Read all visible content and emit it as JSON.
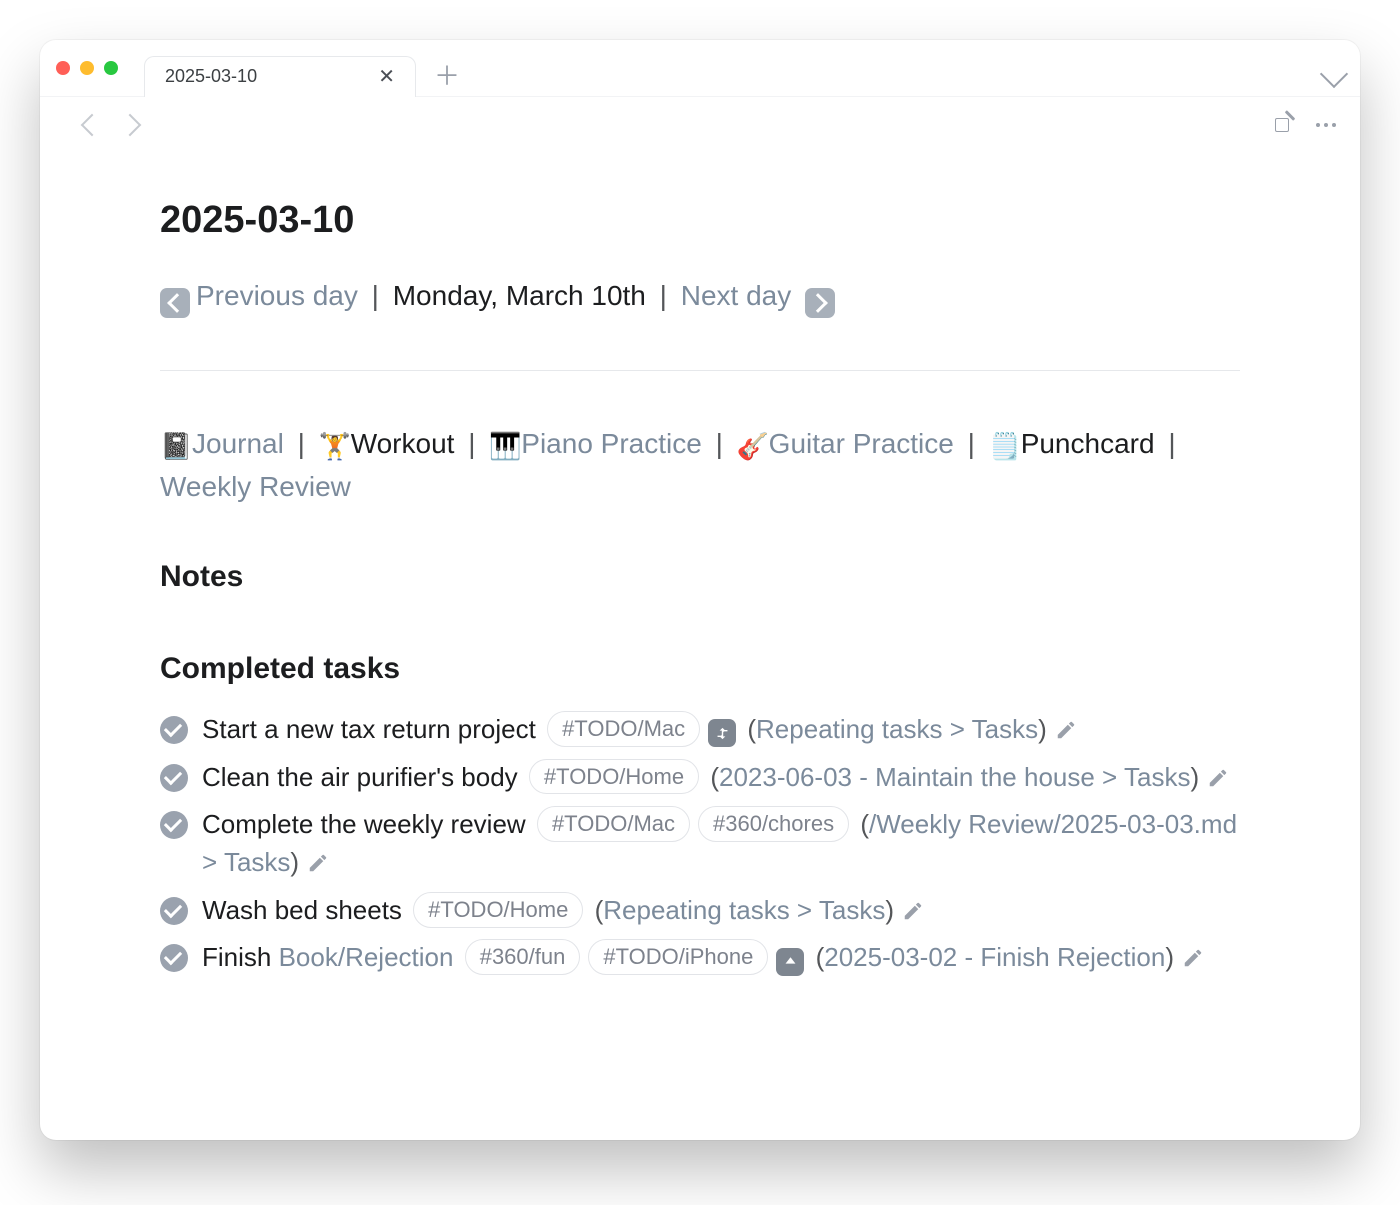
{
  "tab": {
    "title": "2025-03-10"
  },
  "page": {
    "title": "2025-03-10",
    "prev_label": "Previous day",
    "date_label": "Monday, March 10th",
    "next_label": "Next day"
  },
  "quicklinks": [
    {
      "emoji": "📓",
      "label": "Journal",
      "style": "link"
    },
    {
      "emoji": "🏋️",
      "label": "Workout",
      "style": "black"
    },
    {
      "emoji": "🎹",
      "label": "Piano Practice",
      "style": "link"
    },
    {
      "emoji": "🎸",
      "label": "Guitar Practice",
      "style": "link"
    },
    {
      "emoji": "🗒️",
      "label": "Punchcard",
      "style": "black"
    },
    {
      "emoji": "",
      "label": "Weekly Review",
      "style": "link"
    }
  ],
  "headings": {
    "notes": "Notes",
    "completed": "Completed tasks"
  },
  "tasks": [
    {
      "text_before": "Start a new tax return project",
      "link_text": "",
      "text_after": "",
      "tags": [
        "#TODO/Mac"
      ],
      "badge": "repeat",
      "source": "Repeating tasks > Tasks"
    },
    {
      "text_before": "Clean the air purifier's body",
      "link_text": "",
      "text_after": "",
      "tags": [
        "#TODO/Home"
      ],
      "badge": "",
      "source": "2023-06-03 - Maintain the house > Tasks"
    },
    {
      "text_before": "Complete the weekly review",
      "link_text": "",
      "text_after": "",
      "tags": [
        "#TODO/Mac",
        "#360/chores"
      ],
      "badge": "",
      "source": "/Weekly Review/2025-03-03.md > Tasks"
    },
    {
      "text_before": "Wash bed sheets",
      "link_text": "",
      "text_after": "",
      "tags": [
        "#TODO/Home"
      ],
      "badge": "",
      "source": "Repeating tasks > Tasks"
    },
    {
      "text_before": "Finish ",
      "link_text": "Book/Rejection",
      "text_after": "",
      "tags": [
        "#360/fun",
        "#TODO/iPhone"
      ],
      "badge": "up",
      "source": "2025-03-02 - Finish Rejection"
    }
  ]
}
